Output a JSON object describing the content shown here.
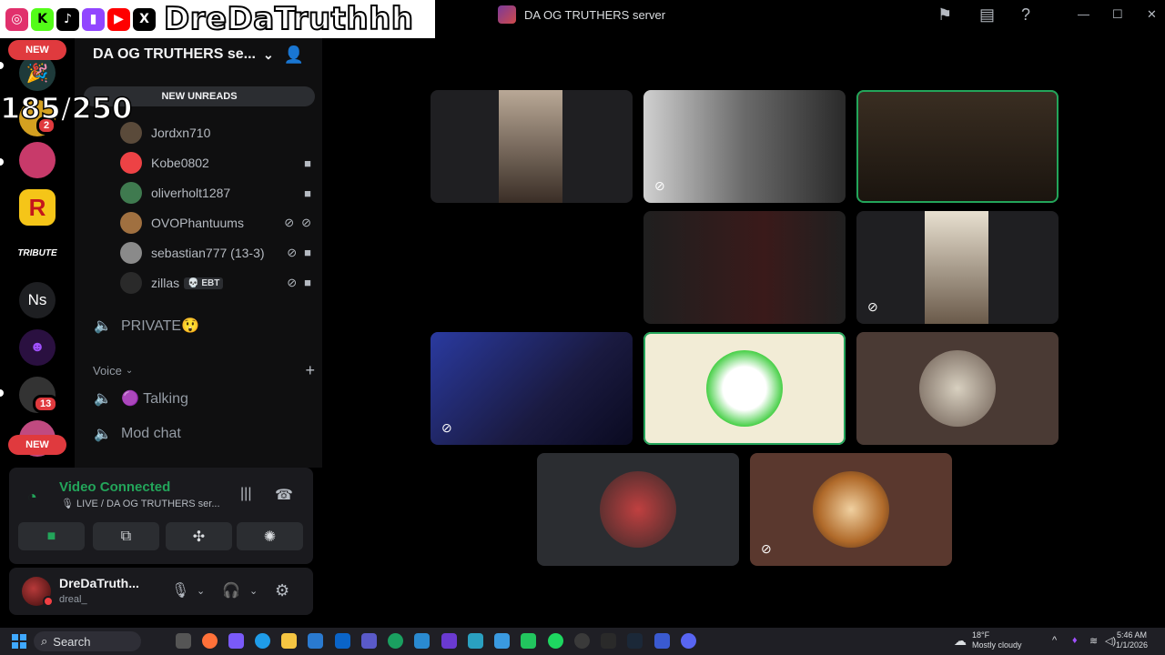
{
  "overlay": {
    "handle": "DreDaTruthhh",
    "viewer_count": "185/250",
    "socials": [
      {
        "icon": "instagram-icon",
        "color": "#e1306c",
        "glyph": "◎"
      },
      {
        "icon": "kick-icon",
        "color": "#53fc18",
        "glyph": "K"
      },
      {
        "icon": "tiktok-icon",
        "color": "#000000",
        "glyph": "♪"
      },
      {
        "icon": "twitch-icon",
        "color": "#9146ff",
        "glyph": "▮"
      },
      {
        "icon": "youtube-icon",
        "color": "#ff0000",
        "glyph": "▶"
      },
      {
        "icon": "x-icon",
        "color": "#000000",
        "glyph": "X"
      }
    ]
  },
  "rail": {
    "new_label_top": "NEW",
    "new_label_bottom": "NEW",
    "badge_2": "2",
    "badge_13": "13",
    "servers": [
      {
        "name": "server-party-icon",
        "text": "🎉"
      },
      {
        "name": "server-gold-icon",
        "text": ""
      },
      {
        "name": "server-pink-icon",
        "text": ""
      },
      {
        "name": "server-rockstar-icon",
        "text": "R"
      },
      {
        "name": "server-tribute-icon",
        "text": "TRIBUTE"
      },
      {
        "name": "server-ns-icon",
        "text": "Ns"
      },
      {
        "name": "server-purple-face-icon",
        "text": ""
      },
      {
        "name": "server-bird-icon",
        "text": ""
      },
      {
        "name": "server-pink2-icon",
        "text": ""
      }
    ]
  },
  "sidebar": {
    "server_name": "DA OG TRUTHERS se...",
    "new_unreads": "NEW UNREADS",
    "voice_users": [
      {
        "name": "Jordxn710",
        "color": "#5a4a3a",
        "icons": ""
      },
      {
        "name": "Kobe0802",
        "color": "#ed4245",
        "icons": "■"
      },
      {
        "name": "oliverholt1287",
        "color": "#3f7a4f",
        "icons": "■"
      },
      {
        "name": "OVOPhantuums",
        "color": "#a07040",
        "icons": "⊘ ⊘"
      },
      {
        "name": "sebastian777 (13-3)",
        "color": "#8a8a8a",
        "icons": "⊘ ■"
      },
      {
        "name": "zillas",
        "color": "#2a2a2a",
        "icons": "⊘ ■",
        "tag": "💀 EBT"
      }
    ],
    "channels": {
      "private": "PRIVATE😲",
      "voice_category": "Voice",
      "talking": "🟣 Talking",
      "mod_chat": "Mod chat"
    }
  },
  "voice_panel": {
    "status": "Video Connected",
    "location": "🎙 LIVE / DA OG TRUTHERS ser..."
  },
  "user_panel": {
    "display_name": "DreDaTruth...",
    "username": "dreal_"
  },
  "titlebar": {
    "server_title": "DA OG TRUTHERS server"
  },
  "taskbar": {
    "search_placeholder": "Search",
    "weather_temp": "18°F",
    "weather_desc": "Mostly cloudy",
    "time": "5:46 AM",
    "date": "1/1/2026"
  }
}
